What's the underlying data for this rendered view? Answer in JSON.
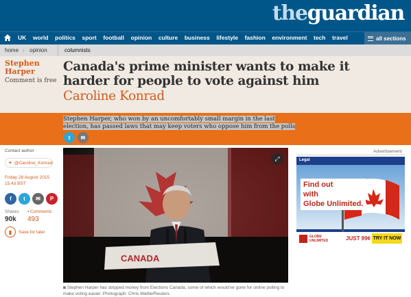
{
  "masthead": {
    "logo_the": "the",
    "logo_guardian": "guardian"
  },
  "nav": {
    "items": [
      "UK",
      "world",
      "politics",
      "sport",
      "football",
      "opinion",
      "culture",
      "business",
      "lifestyle",
      "fashion",
      "environment",
      "tech",
      "travel"
    ],
    "all_sections": "all sections"
  },
  "breadcrumb": {
    "home": "home",
    "opinion": "opinion",
    "current": "columnists"
  },
  "article": {
    "series_author": "Stephen Harper",
    "series_line1": "Stephen",
    "series_line2": "Harper",
    "comment_free": "Comment is free",
    "headline": "Canada's prime minister wants to make it harder for people to vote against him",
    "byline": "Caroline Konrad",
    "standfirst": "Stephen Harper, who won by an uncomfortably small margin in the last election, has passed laws that may keep voters who oppose him from the polls"
  },
  "meta": {
    "contact_author": "Contact author",
    "twitter_handle": "@Caroline_Konrad",
    "date": "Friday 28 August 2015",
    "time": "15.43 BST",
    "shares_label": "Shares",
    "shares_value": "90k",
    "comments_label": "Comments",
    "comments_value": "493",
    "save_for_later": "Save for later"
  },
  "photo": {
    "sign_text": "CANADA",
    "caption": "Stephen Harper has stripped money from Elections Canada, some of which would've gone for online polling to make voting easier. Photograph: Chris Wattie/Reuters"
  },
  "ad": {
    "label": "Advertisement",
    "legal": "Legal",
    "line1": "Find out",
    "line2": "with",
    "line3": "Globe Unlimited.",
    "logo_line1": "GLOBE",
    "logo_line2": "UNLIMITED",
    "price": "JUST 99¢",
    "cta": "TRY IT NOW"
  },
  "colors": {
    "brand_blue": "#005689",
    "orange_accent": "#e96f18",
    "band_beige": "#f1eae2"
  },
  "icons": [
    "home-icon",
    "hamburger-icon",
    "twitter-icon",
    "email-icon",
    "facebook-icon",
    "pinterest-icon",
    "expand-icon",
    "camera-icon",
    "bookmark-icon"
  ]
}
